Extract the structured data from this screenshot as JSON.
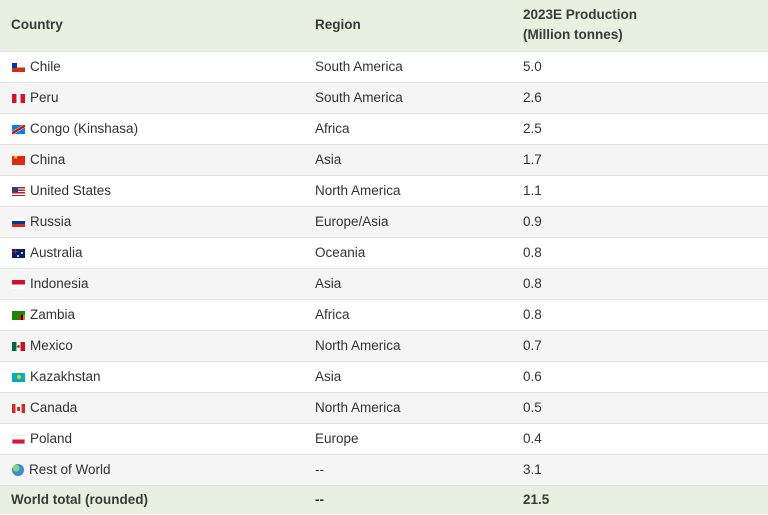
{
  "table": {
    "headers": {
      "country": "Country",
      "region": "Region",
      "production_line1": "2023E Production",
      "production_line2": "(Million tonnes)"
    },
    "rows": [
      {
        "flag": "chile-flag-icon",
        "country": "Chile",
        "region": "South America",
        "production": "5.0"
      },
      {
        "flag": "peru-flag-icon",
        "country": "Peru",
        "region": "South America",
        "production": "2.6"
      },
      {
        "flag": "congo-flag-icon",
        "country": "Congo (Kinshasa)",
        "region": "Africa",
        "production": "2.5"
      },
      {
        "flag": "china-flag-icon",
        "country": "China",
        "region": "Asia",
        "production": "1.7"
      },
      {
        "flag": "us-flag-icon",
        "country": "United States",
        "region": "North America",
        "production": "1.1"
      },
      {
        "flag": "russia-flag-icon",
        "country": "Russia",
        "region": "Europe/Asia",
        "production": "0.9"
      },
      {
        "flag": "australia-flag-icon",
        "country": "Australia",
        "region": "Oceania",
        "production": "0.8"
      },
      {
        "flag": "indonesia-flag-icon",
        "country": "Indonesia",
        "region": "Asia",
        "production": "0.8"
      },
      {
        "flag": "zambia-flag-icon",
        "country": "Zambia",
        "region": "Africa",
        "production": "0.8"
      },
      {
        "flag": "mexico-flag-icon",
        "country": "Mexico",
        "region": "North America",
        "production": "0.7"
      },
      {
        "flag": "kazakhstan-flag-icon",
        "country": "Kazakhstan",
        "region": "Asia",
        "production": "0.6"
      },
      {
        "flag": "canada-flag-icon",
        "country": "Canada",
        "region": "North America",
        "production": "0.5"
      },
      {
        "flag": "poland-flag-icon",
        "country": "Poland",
        "region": "Europe",
        "production": "0.4"
      },
      {
        "flag": "globe-icon",
        "country": "Rest of World",
        "region": "--",
        "production": "3.1"
      }
    ],
    "total": {
      "country": "World total (rounded)",
      "region": "--",
      "production": "21.5"
    }
  },
  "colors": {
    "header_background": "#e8f0e0",
    "stripe_background": "#f5f5f5",
    "text": "#333333"
  }
}
